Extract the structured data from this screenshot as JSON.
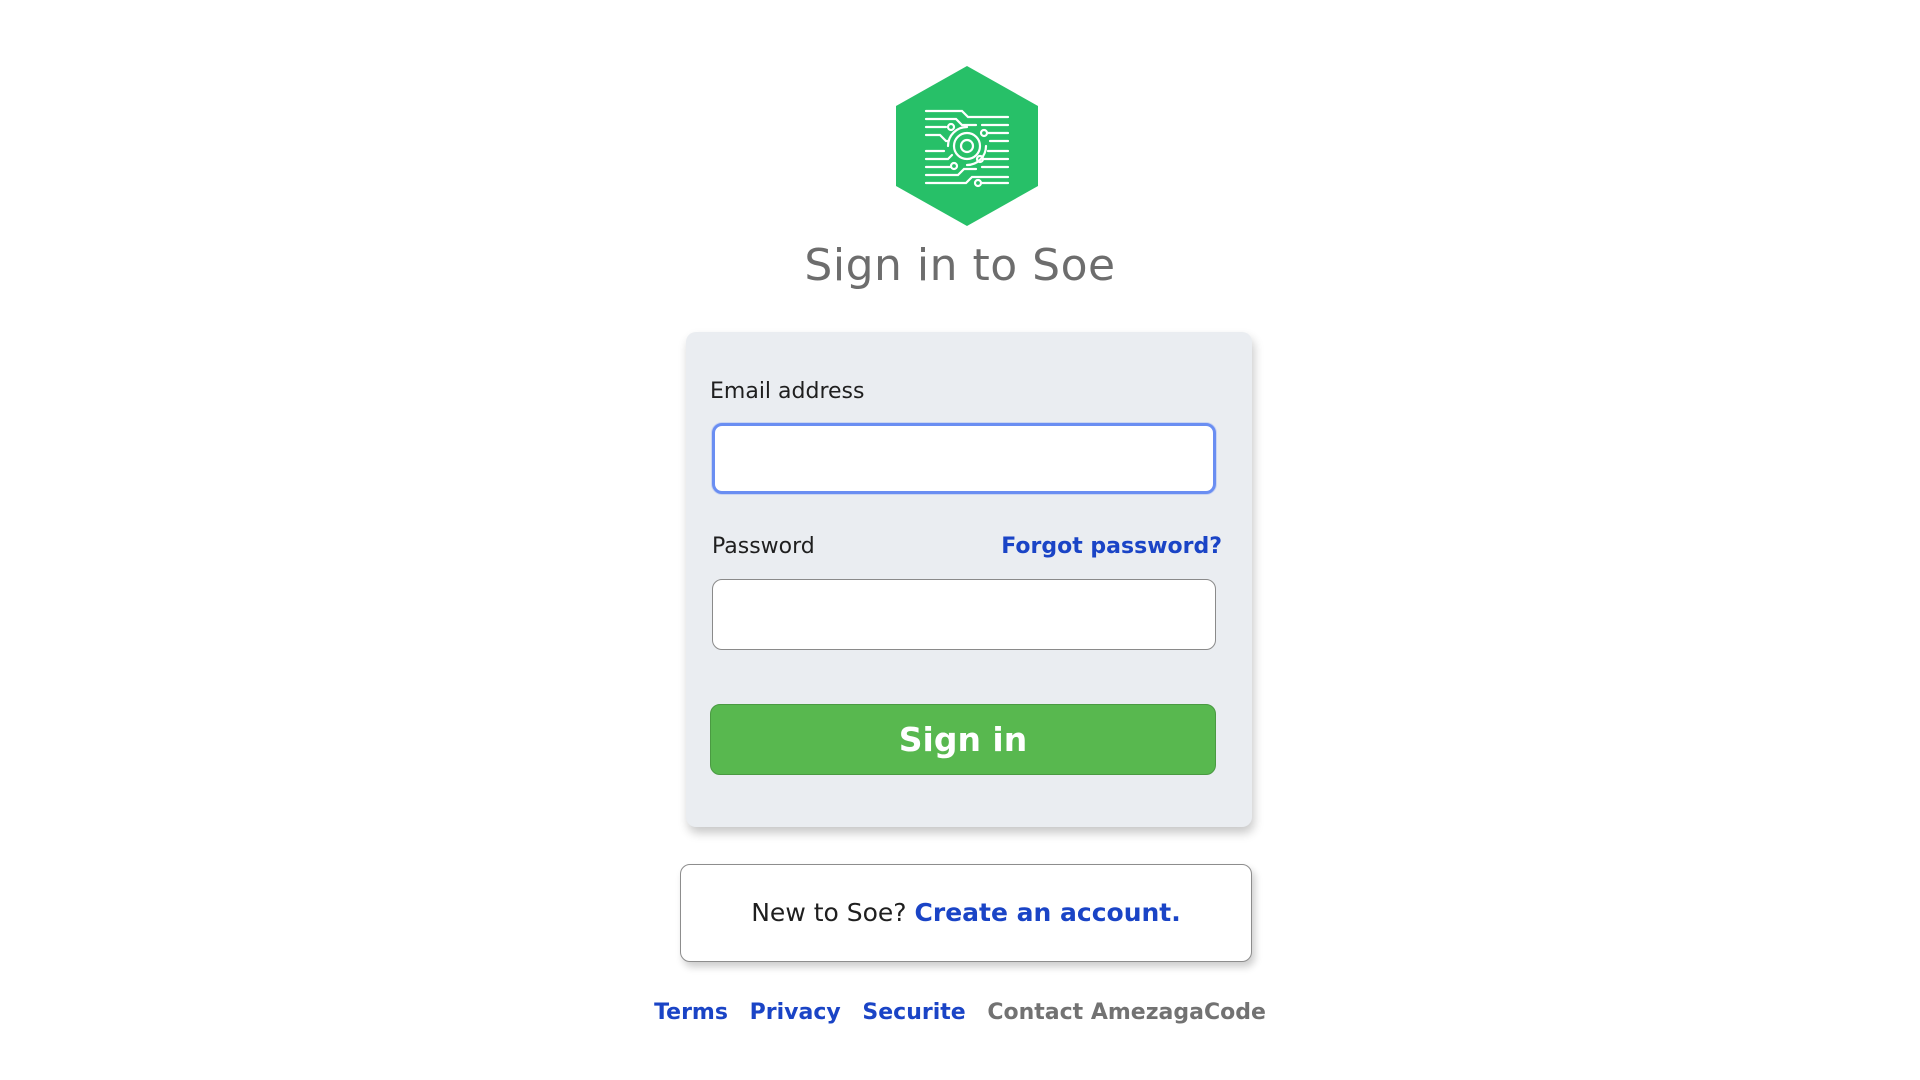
{
  "logo": {
    "icon": "circuit-hexagon-logo",
    "color": "#27c068"
  },
  "title": "Sign in to Soe",
  "form": {
    "email_label": "Email address",
    "email_value": "",
    "password_label": "Password",
    "password_value": "",
    "forgot_label": "Forgot password?",
    "submit_label": "Sign in"
  },
  "signup": {
    "prompt": "New to Soe?",
    "link_label": "Create an account."
  },
  "footer": {
    "links": [
      "Terms",
      "Privacy",
      "Securite"
    ],
    "contact": "Contact AmezagaCode"
  },
  "colors": {
    "link": "#1a44c6",
    "button": "#58b84f",
    "focus_border": "#6a8ef2",
    "card_bg": "#eaedf1"
  }
}
